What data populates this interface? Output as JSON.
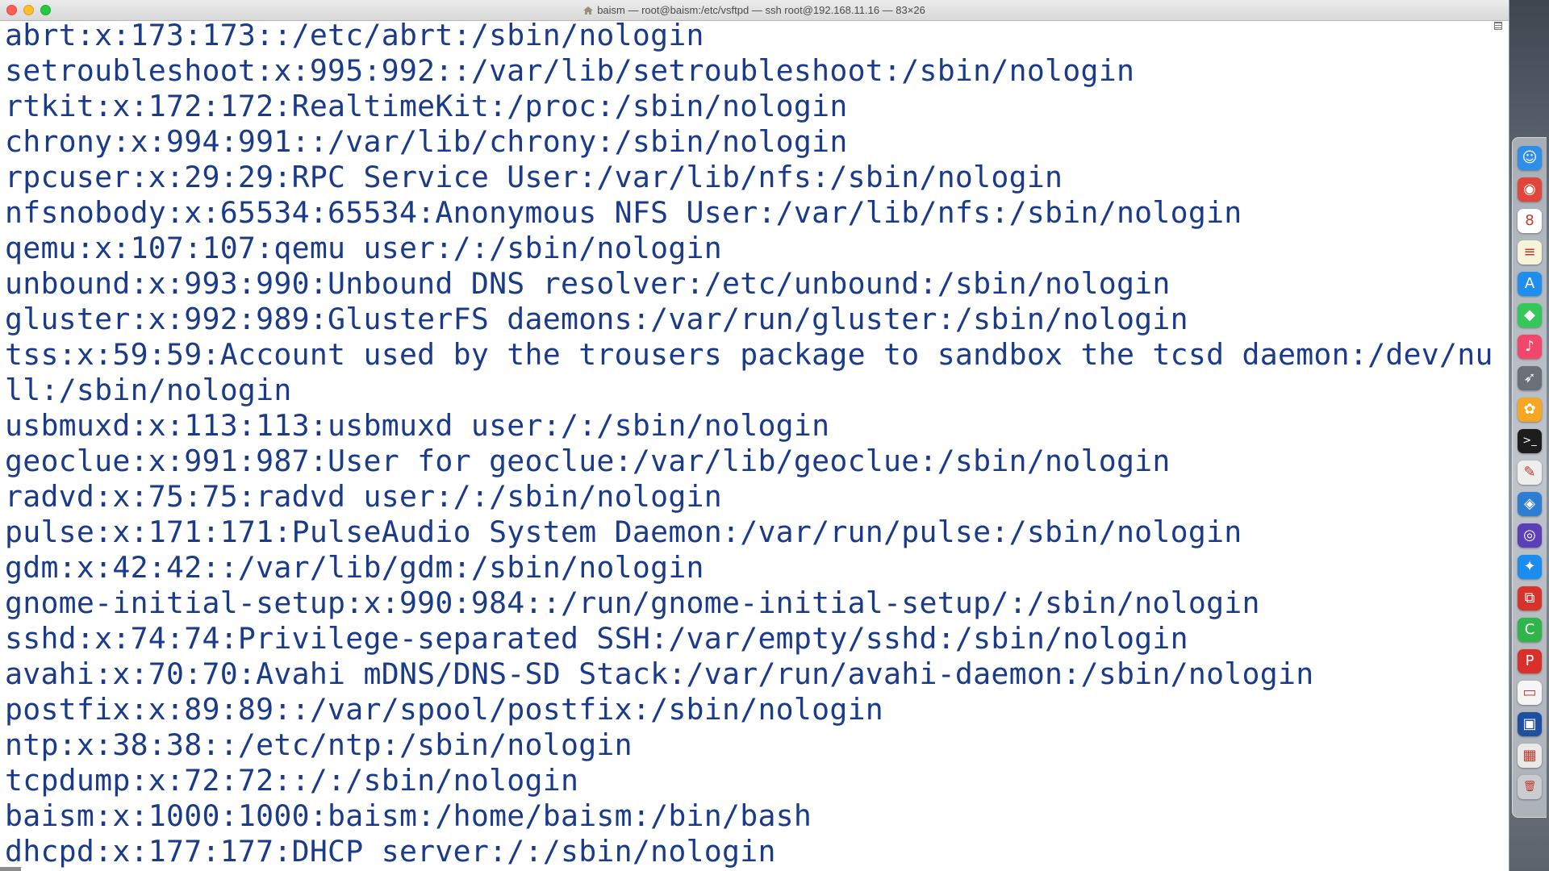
{
  "window": {
    "title": "baism — root@baism:/etc/vsftpd — ssh root@192.168.11.16 — 83×26"
  },
  "terminal": {
    "lines": [
      "abrt:x:173:173::/etc/abrt:/sbin/nologin",
      "setroubleshoot:x:995:992::/var/lib/setroubleshoot:/sbin/nologin",
      "rtkit:x:172:172:RealtimeKit:/proc:/sbin/nologin",
      "chrony:x:994:991::/var/lib/chrony:/sbin/nologin",
      "rpcuser:x:29:29:RPC Service User:/var/lib/nfs:/sbin/nologin",
      "nfsnobody:x:65534:65534:Anonymous NFS User:/var/lib/nfs:/sbin/nologin",
      "qemu:x:107:107:qemu user:/:/sbin/nologin",
      "unbound:x:993:990:Unbound DNS resolver:/etc/unbound:/sbin/nologin",
      "gluster:x:992:989:GlusterFS daemons:/var/run/gluster:/sbin/nologin",
      "tss:x:59:59:Account used by the trousers package to sandbox the tcsd daemon:/dev/nu",
      "ll:/sbin/nologin",
      "usbmuxd:x:113:113:usbmuxd user:/:/sbin/nologin",
      "geoclue:x:991:987:User for geoclue:/var/lib/geoclue:/sbin/nologin",
      "radvd:x:75:75:radvd user:/:/sbin/nologin",
      "pulse:x:171:171:PulseAudio System Daemon:/var/run/pulse:/sbin/nologin",
      "gdm:x:42:42::/var/lib/gdm:/sbin/nologin",
      "gnome-initial-setup:x:990:984::/run/gnome-initial-setup/:/sbin/nologin",
      "sshd:x:74:74:Privilege-separated SSH:/var/empty/sshd:/sbin/nologin",
      "avahi:x:70:70:Avahi mDNS/DNS-SD Stack:/var/run/avahi-daemon:/sbin/nologin",
      "postfix:x:89:89::/var/spool/postfix:/sbin/nologin",
      "ntp:x:38:38::/etc/ntp:/sbin/nologin",
      "tcpdump:x:72:72::/:/sbin/nologin",
      "baism:x:1000:1000:baism:/home/baism:/bin/bash",
      "dhcpd:x:177:177:DHCP server:/:/sbin/nologin"
    ]
  },
  "dock": {
    "icons": [
      {
        "name": "finder-icon",
        "glyph": "☺",
        "color": "#2f8fe8"
      },
      {
        "name": "chrome-icon",
        "glyph": "◉",
        "color": "#e2453c"
      },
      {
        "name": "calendar-icon",
        "glyph": "8",
        "color": "#ffffff"
      },
      {
        "name": "notes-icon",
        "glyph": "≡",
        "color": "#f7f3d8"
      },
      {
        "name": "app-store-icon",
        "glyph": "A",
        "color": "#1f8ef1"
      },
      {
        "name": "messages-icon",
        "glyph": "◆",
        "color": "#34c759"
      },
      {
        "name": "music-icon",
        "glyph": "♪",
        "color": "#f0476a"
      },
      {
        "name": "launchpad-icon",
        "glyph": "➶",
        "color": "#6b6f78"
      },
      {
        "name": "photos-icon",
        "glyph": "✿",
        "color": "#f6a623"
      },
      {
        "name": "terminal-icon",
        "glyph": ">_",
        "color": "#1d1d1d"
      },
      {
        "name": "textedit-icon",
        "glyph": "✎",
        "color": "#eeeeee"
      },
      {
        "name": "xcode-icon",
        "glyph": "◈",
        "color": "#2d7dd2"
      },
      {
        "name": "siri-icon",
        "glyph": "◎",
        "color": "#5a3fb8"
      },
      {
        "name": "safari-icon",
        "glyph": "✦",
        "color": "#1b8cf0"
      },
      {
        "name": "remote-desktop-icon",
        "glyph": "⧉",
        "color": "#d8332b"
      },
      {
        "name": "facetime-icon",
        "glyph": "C",
        "color": "#2fb54a"
      },
      {
        "name": "pdf-reader-icon",
        "glyph": "P",
        "color": "#d9302c"
      },
      {
        "name": "document-icon",
        "glyph": "▭",
        "color": "#f5f5f5"
      },
      {
        "name": "screen-app-icon",
        "glyph": "▣",
        "color": "#1f4fa0"
      },
      {
        "name": "video-app-icon",
        "glyph": "▦",
        "color": "#e9e9e9"
      },
      {
        "name": "trash-icon",
        "glyph": "🗑",
        "color": "#c9ccd1"
      }
    ]
  }
}
